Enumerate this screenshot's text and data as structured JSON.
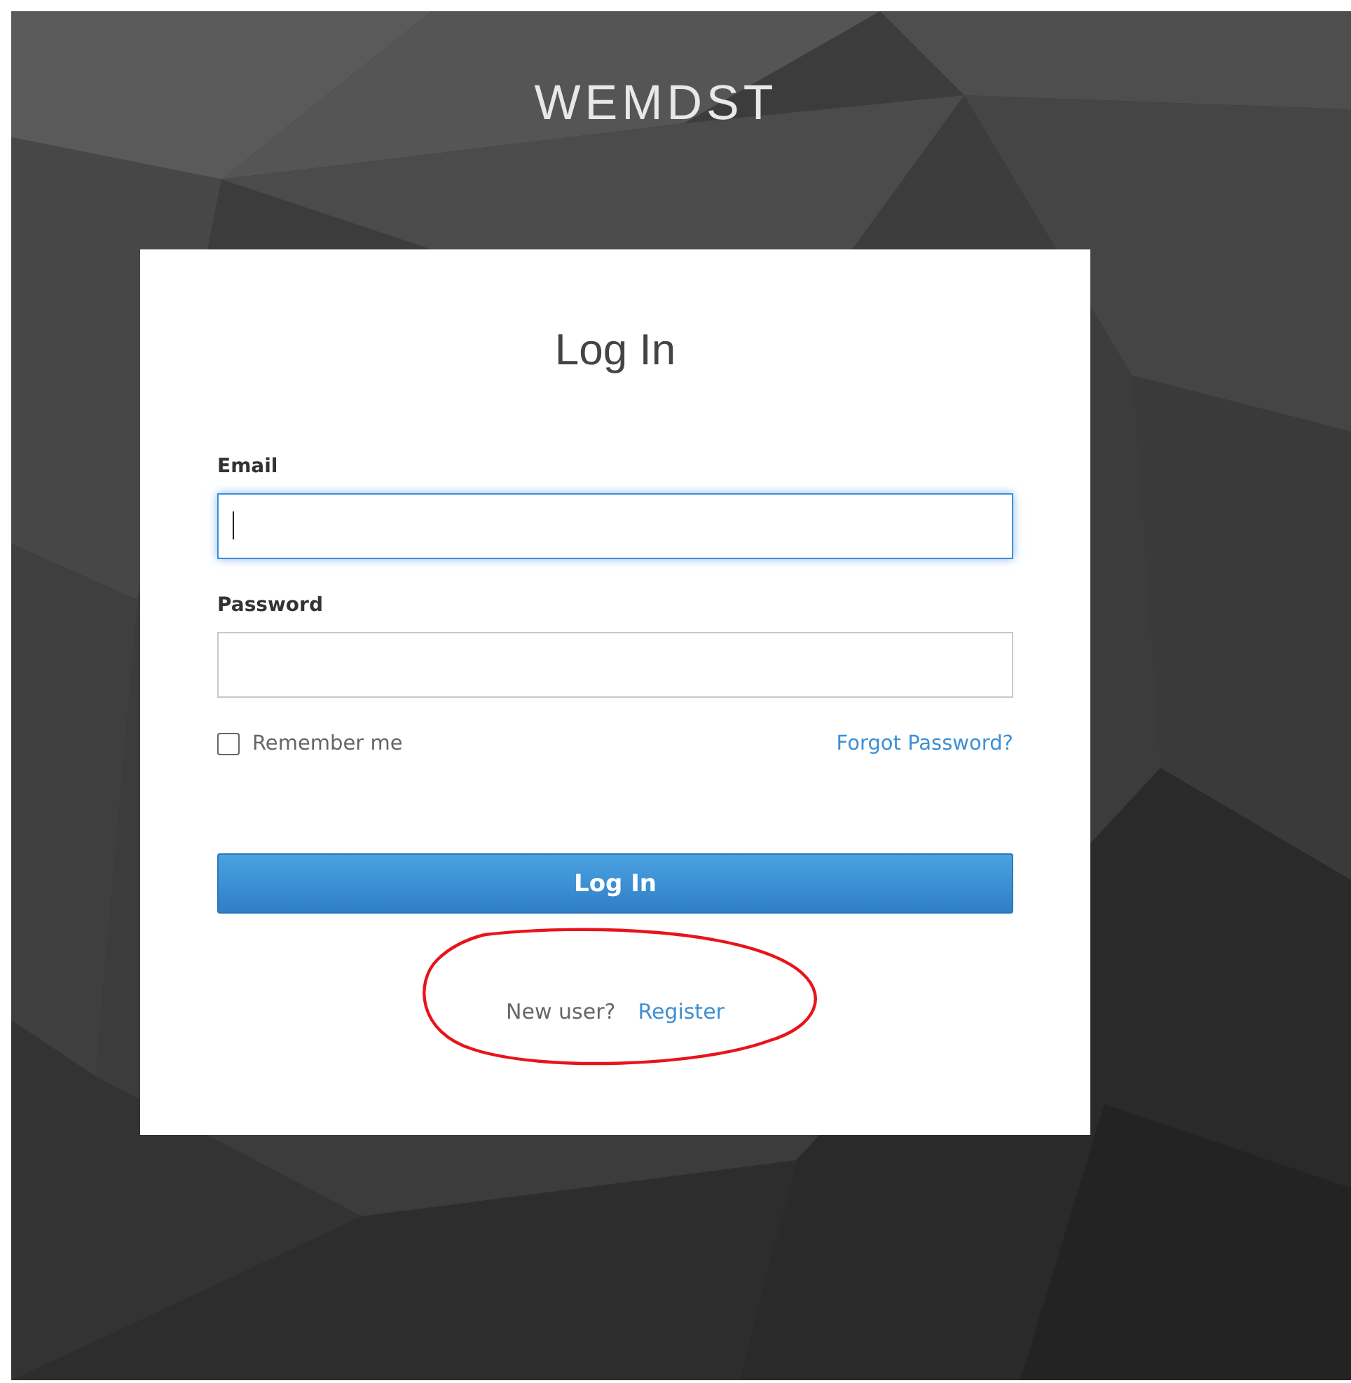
{
  "brand": "WEMDST",
  "login_card": {
    "title": "Log In",
    "fields": [
      {
        "label": "Email",
        "focused": true
      },
      {
        "label": "Password",
        "focused": false
      }
    ],
    "remember_me": {
      "label": "Remember me",
      "checked": false
    },
    "forgot_password_link": "Forgot Password?",
    "submit_button": "Log In",
    "register": {
      "prompt": "New user?",
      "link": "Register"
    }
  }
}
